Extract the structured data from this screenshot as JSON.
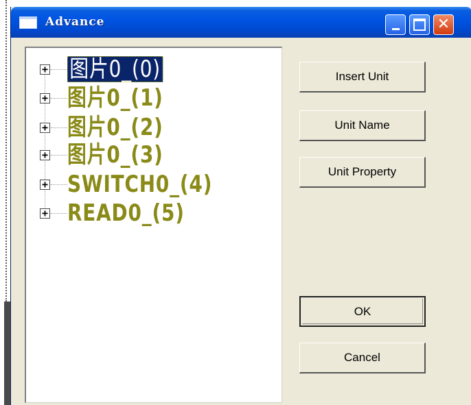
{
  "window": {
    "title": "Advance",
    "controls": {
      "minimize_icon": "minimize-icon",
      "maximize_icon": "maximize-icon",
      "close_icon": "close-icon",
      "close_glyph": "✕"
    }
  },
  "tree": {
    "expander_glyph": "+",
    "selected_index": 0,
    "items": [
      {
        "label": "图片0_(0)"
      },
      {
        "label": "图片0_(1)"
      },
      {
        "label": "图片0_(2)"
      },
      {
        "label": "图片0_(3)"
      },
      {
        "label": "SWITCH0_(4)"
      },
      {
        "label": "READ0_(5)"
      }
    ]
  },
  "buttons": {
    "insert_unit": "Insert Unit",
    "unit_name": "Unit Name",
    "unit_property": "Unit Property",
    "ok": "OK",
    "cancel": "Cancel"
  },
  "colors": {
    "titlebar": "#0054e3",
    "dialog_bg": "#ece9d8",
    "tree_text": "#8a8a18",
    "selection_bg": "#0a246a"
  }
}
